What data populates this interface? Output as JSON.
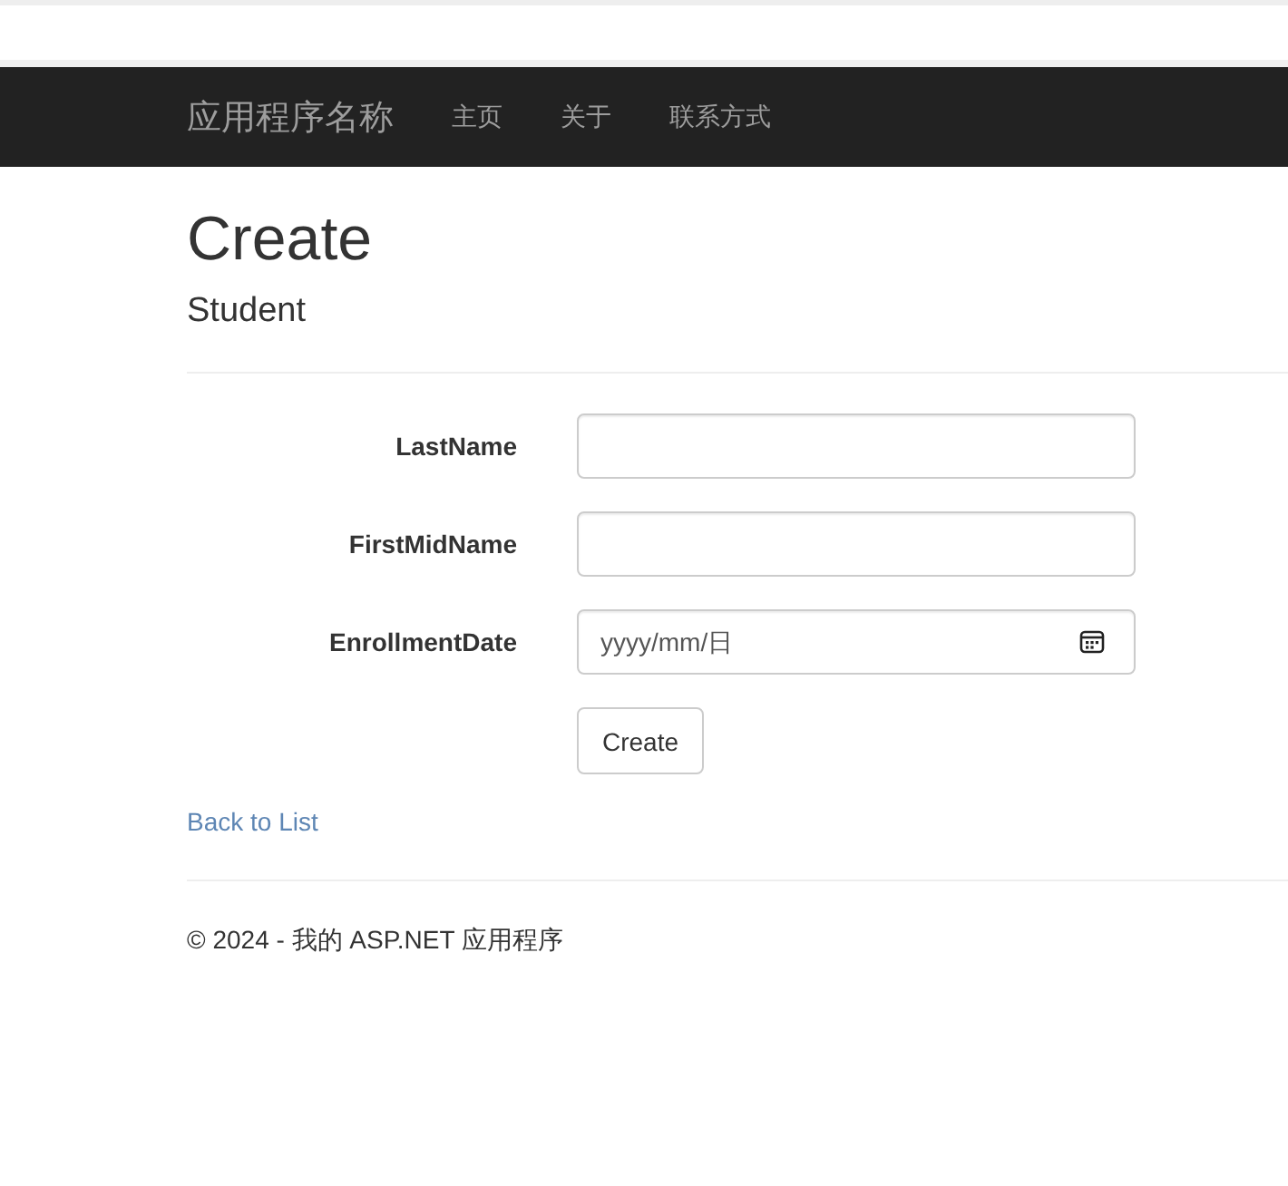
{
  "navbar": {
    "brand": "应用程序名称",
    "links": [
      "主页",
      "关于",
      "联系方式"
    ]
  },
  "heading": "Create",
  "subheading": "Student",
  "fields": [
    {
      "label": "LastName",
      "kind": "text"
    },
    {
      "label": "FirstMidName",
      "kind": "text"
    },
    {
      "label": "EnrollmentDate",
      "kind": "date",
      "placeholder": "yyyy/mm/日"
    }
  ],
  "submit_button": "Create",
  "back_link": "Back to List",
  "footer": "© 2024 - 我的 ASP.NET 应用程序"
}
